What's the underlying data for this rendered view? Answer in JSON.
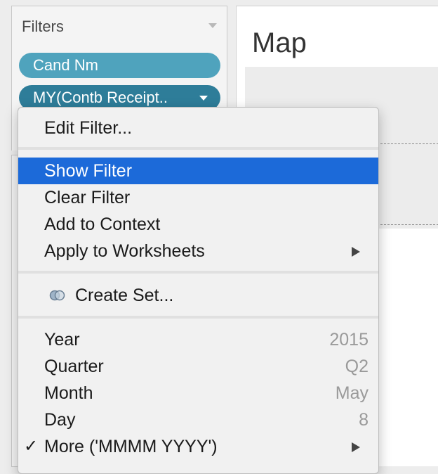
{
  "filters": {
    "title": "Filters",
    "pills": [
      {
        "label": "Cand Nm"
      },
      {
        "label": "MY(Contb Receipt.."
      }
    ]
  },
  "sheet": {
    "title": "Map"
  },
  "menu": {
    "edit_filter": "Edit Filter...",
    "show_filter": "Show Filter",
    "clear_filter": "Clear Filter",
    "add_to_context": "Add to Context",
    "apply_to_worksheets": "Apply to Worksheets",
    "create_set": "Create Set...",
    "date_parts": [
      {
        "label": "Year",
        "value": "2015"
      },
      {
        "label": "Quarter",
        "value": "Q2"
      },
      {
        "label": "Month",
        "value": "May"
      },
      {
        "label": "Day",
        "value": "8"
      }
    ],
    "more": "More ('MMMM YYYY')",
    "check_mark": "✓"
  },
  "colors": {
    "highlight": "#1c6ad9",
    "pill_light": "#4fa3bd",
    "pill_dark": "#2e7d99"
  }
}
